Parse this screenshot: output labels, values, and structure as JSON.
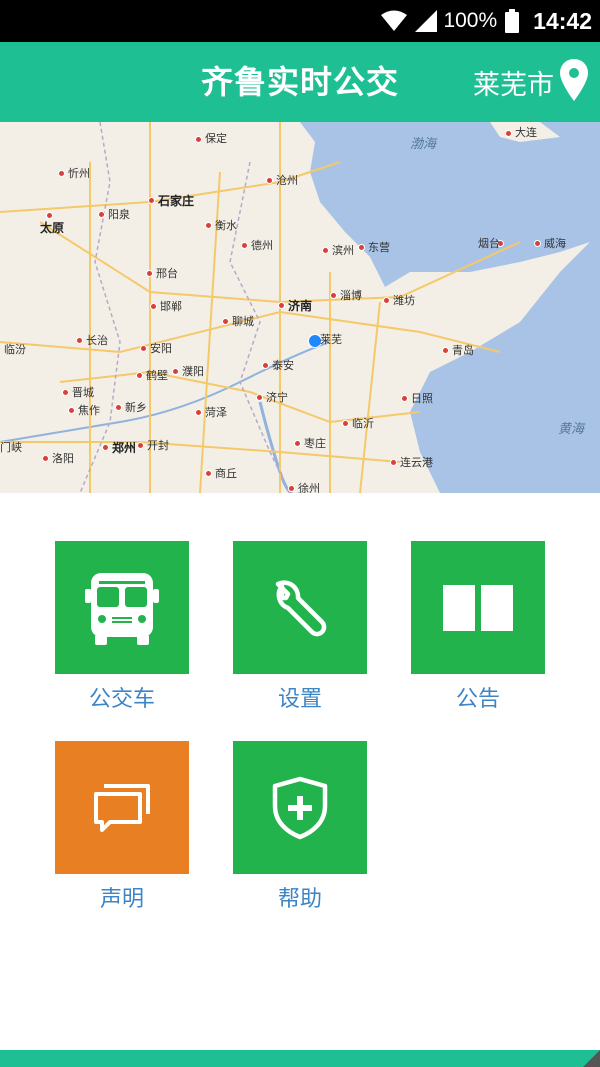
{
  "status_bar": {
    "battery": "100%",
    "time": "14:42"
  },
  "header": {
    "title": "齐鲁实时公交",
    "city": "莱芜市"
  },
  "map": {
    "sea_labels": [
      "渤海",
      "黄海"
    ],
    "cities": [
      "大连",
      "保定",
      "沧州",
      "忻州",
      "石家庄",
      "太原",
      "阳泉",
      "衡水",
      "德州",
      "滨州",
      "东营",
      "烟台",
      "威海",
      "邢台",
      "济南",
      "淄博",
      "潍坊",
      "邯郸",
      "聊城",
      "莱芜",
      "长治",
      "安阳",
      "临汾",
      "青岛",
      "鹤壁",
      "濮阳",
      "晋城",
      "泰安",
      "济宁",
      "日照",
      "焦作",
      "新乡",
      "菏泽",
      "临沂",
      "枣庄",
      "门峡",
      "郑州",
      "开封",
      "洛阳",
      "商丘",
      "连云港",
      "徐州"
    ]
  },
  "menu": {
    "bus": "公交车",
    "settings": "设置",
    "notice": "公告",
    "statement": "声明",
    "help": "帮助"
  },
  "colors": {
    "header": "#1fbf94",
    "tile_green": "#22b34c",
    "tile_orange": "#e88023",
    "label_blue": "#3d85c6"
  }
}
